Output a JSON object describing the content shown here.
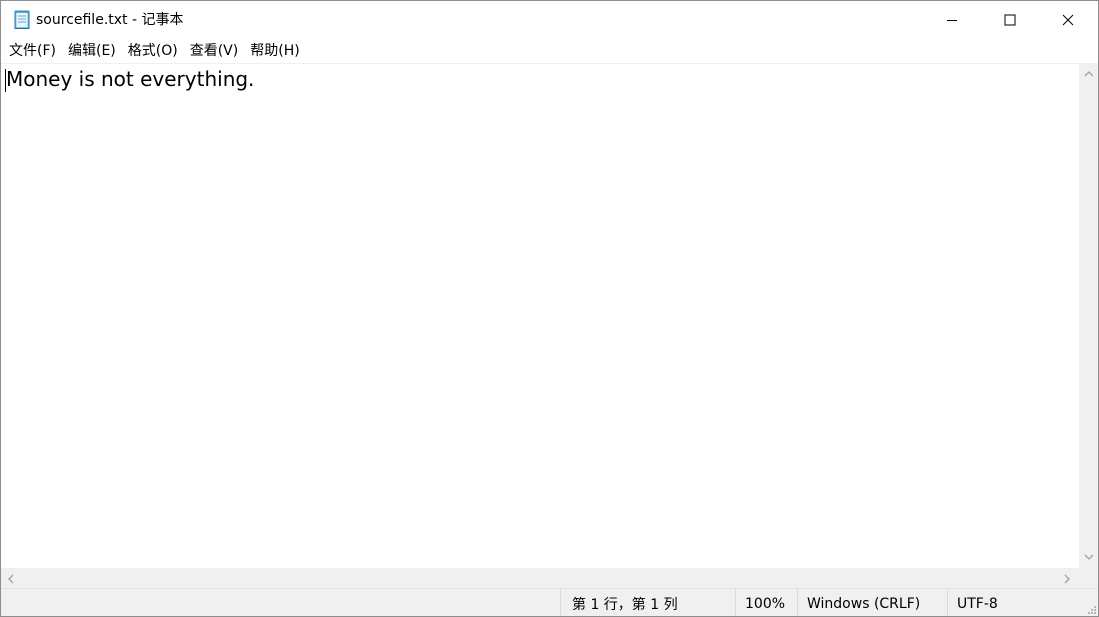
{
  "window": {
    "title": "sourcefile.txt - 记事本",
    "app_icon": "notepad-icon",
    "controls": [
      "minimize-icon",
      "maximize-icon",
      "close-icon"
    ]
  },
  "menu": {
    "items": [
      {
        "label": "文件(F)"
      },
      {
        "label": "编辑(E)"
      },
      {
        "label": "格式(O)"
      },
      {
        "label": "查看(V)"
      },
      {
        "label": "帮助(H)"
      }
    ]
  },
  "editor": {
    "content": "Money is not everything."
  },
  "status": {
    "position": "第 1 行，第 1 列",
    "zoom": "100%",
    "line_ending": "Windows (CRLF)",
    "encoding": "UTF-8"
  },
  "colors": {
    "chrome": "#f0f0f0",
    "background": "#ffffff",
    "border": "#8e8e8e"
  }
}
